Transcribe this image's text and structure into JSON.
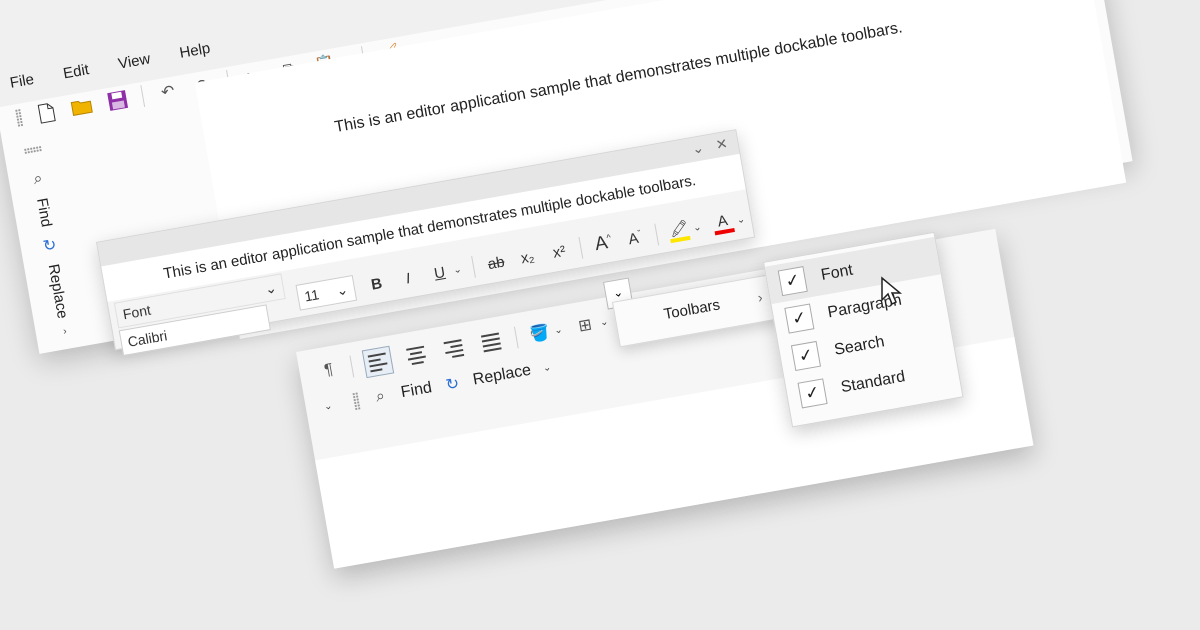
{
  "menu": {
    "items": [
      "File",
      "Edit",
      "View",
      "Help"
    ]
  },
  "document": {
    "text": "This is an editor application sample that demonstrates multiple dockable toolbars."
  },
  "search_vertical": {
    "find": "Find",
    "replace": "Replace"
  },
  "font_toolbar": {
    "font_label": "Font",
    "font_name": "Calibri",
    "font_size": "11",
    "bold": "B",
    "italic": "I",
    "underline": "U"
  },
  "search_toolbar": {
    "find": "Find",
    "replace": "Replace"
  },
  "context_menu": {
    "toolbars": "Toolbars"
  },
  "toolbars_submenu": [
    {
      "label": "Font",
      "checked": true
    },
    {
      "label": "Paragraph",
      "checked": true
    },
    {
      "label": "Search",
      "checked": true
    },
    {
      "label": "Standard",
      "checked": true
    }
  ],
  "colors": {
    "highlight": "#ffe600",
    "font_color": "#e00000",
    "save_purple": "#8e2fa8",
    "open_yellow": "#f0b400"
  }
}
